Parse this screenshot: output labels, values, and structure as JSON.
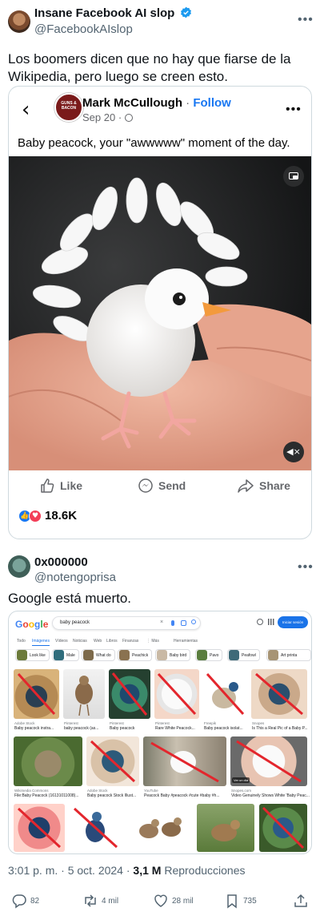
{
  "author": {
    "name": "Insane Facebook AI slop",
    "handle": "@FacebookAIslop"
  },
  "tweet_text": "Los boomers dicen que no hay que fiarse de la Wikipedia, pero luego se creen esto.",
  "fb_post": {
    "page_name": "Mark McCullough",
    "separator": " · ",
    "follow_label": "Follow",
    "date": "Sep 20 · ",
    "logo_text": "GUNS & BACON",
    "caption": "Baby peacock, your \"awwwww\" moment of the day.",
    "like_label": "Like",
    "send_label": "Send",
    "share_label": "Share",
    "reaction_count": "18.6K"
  },
  "reply": {
    "name": "0x000000",
    "handle": "@notengoprisa",
    "text": "Google está muerto."
  },
  "google": {
    "logo": "Google",
    "query": "baby peacock",
    "signin_label": "Iniciar sesión",
    "tabs": [
      "Todo",
      "Imágenes",
      "Vídeos",
      "Noticias",
      "Web",
      "Libros",
      "Finanzas",
      "⋮ Más",
      "Herramientas"
    ],
    "chips": [
      "Look like",
      "Male",
      "What do",
      "Peachick",
      "Baby bird",
      "Pavo",
      "Peafowl",
      "Art printa"
    ],
    "row1": [
      {
        "src": "Adobe Stock",
        "title": "Baby peacock instra..."
      },
      {
        "src": "Pinterest",
        "title": "baby peacock (as..."
      },
      {
        "src": "Pinterest",
        "title": "Baby peacock"
      },
      {
        "src": "Pinterest",
        "title": "Rare White Peacock..."
      },
      {
        "src": "Freepik",
        "title": "Baby peacock isolat..."
      },
      {
        "src": "Snopes",
        "title": "Is This a Real Pic of a Baby P..."
      }
    ],
    "row2": [
      {
        "src": "Wikimedia Commons",
        "title": "File:Baby Peacock (16131011008)..."
      },
      {
        "src": "Adobe Stock",
        "title": "Baby peacock Stock Illust..."
      },
      {
        "src": "YouTube",
        "title": "Peacock Baby #peacock #cute #baby #h..."
      },
      {
        "src": "Snopes.com",
        "title": "Video Genuinely Shows White 'Baby Peac..."
      }
    ],
    "video_badge": "Ver un día"
  },
  "meta": {
    "time": "3:01 p. m. · 5 oct. 2024 · ",
    "views": "3,1 M",
    "views_label": " Reproducciones"
  },
  "actions": {
    "replies": "82",
    "reposts": "4 mil",
    "likes": "28 mil",
    "bookmarks": "735"
  },
  "colors": {
    "verified": "#1d9bf0",
    "fb_blue": "#1877f2",
    "x_text": "#0f1419",
    "x_muted": "#536471",
    "strike": "#e3262d"
  }
}
